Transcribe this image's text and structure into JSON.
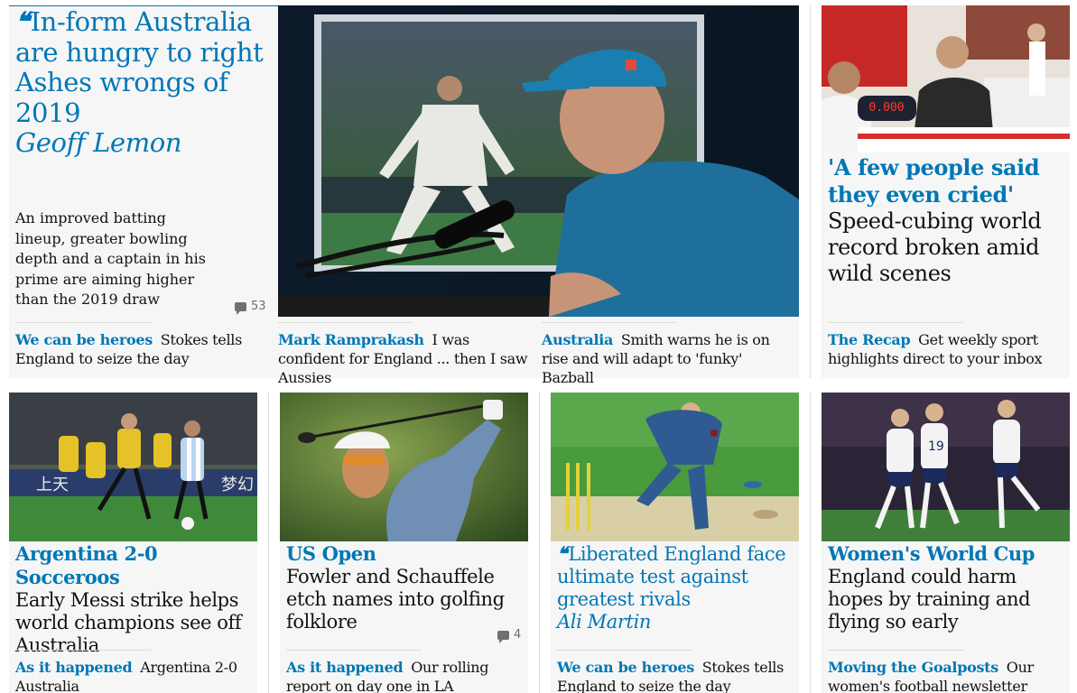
{
  "lead": {
    "headline": "In-form Australia are hungry to right Ashes wrongs of 2019",
    "byline": "Geoff Lemon",
    "standfirst": "An improved batting lineup, greater bowling depth and a captain in his prime are aiming higher than the 2019 draw",
    "comments": "53",
    "image_alt": "Pat Cummins at press conference with Ben Stokes on screen behind"
  },
  "related": [
    {
      "kicker": "We can be heroes",
      "text": "Stokes tells England to seize the day"
    },
    {
      "kicker": "Mark Ramprakash",
      "text": "I was confident for England ... then I saw Aussies"
    },
    {
      "kicker": "Australia",
      "text": "Smith warns he is on rise and will adapt to 'funky' Bazball"
    }
  ],
  "cubing": {
    "kicker": "'A few people said they even cried'",
    "headline": "Speed-cubing world record broken amid wild scenes",
    "timer": "0.000",
    "sub_kicker": "The Recap",
    "sub_text": "Get weekly sport highlights direct to your inbox"
  },
  "cards": [
    {
      "kicker": "Argentina 2-0 Socceroos",
      "headline": "Early Messi strike helps world champions see off Australia",
      "sub_kicker": "As it happened",
      "sub_text": "Argentina 2-0 Australia"
    },
    {
      "kicker": "US Open",
      "headline": "Fowler and Schauffele etch names into golfing folklore",
      "comments": "4",
      "sub_kicker": "As it happened",
      "sub_text": "Our rolling report on day one in LA"
    },
    {
      "headline": "Liberated England face ultimate test against greatest rivals",
      "byline": "Ali Martin",
      "sub_kicker": "We can be heroes",
      "sub_text": "Stokes tells England to seize the day"
    },
    {
      "kicker": "Women's World Cup",
      "headline": "England could harm hopes by training and flying so early",
      "sub_kicker": "Moving the Goalposts",
      "sub_text": "Our women's football newsletter"
    }
  ],
  "colors": {
    "accent": "#0077b6",
    "card_bg": "#f6f6f6",
    "text": "#121212",
    "muted": "#707070"
  }
}
